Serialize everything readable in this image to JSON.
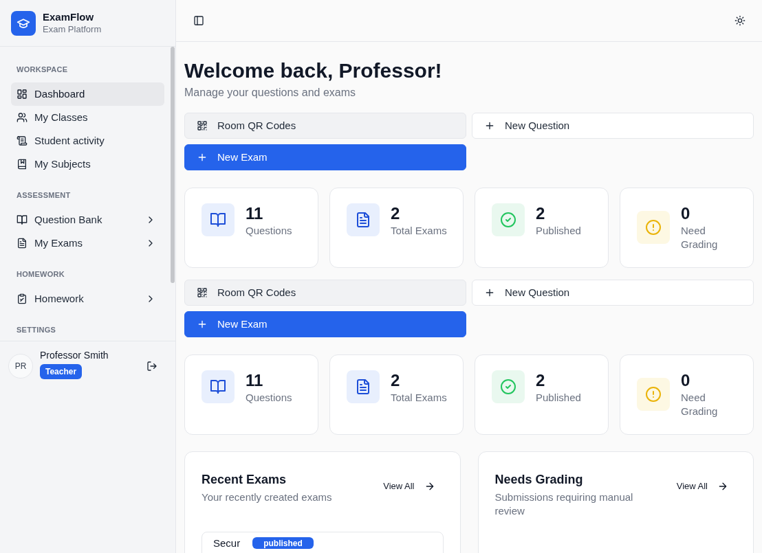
{
  "brand": {
    "name": "ExamFlow",
    "tagline": "Exam Platform"
  },
  "nav_sections": [
    {
      "label": "WORKSPACE",
      "items": [
        {
          "label": "Dashboard",
          "kind": "grid",
          "selected": true,
          "submenu": false
        },
        {
          "label": "My Classes",
          "kind": "users",
          "selected": false,
          "submenu": false
        },
        {
          "label": "Student activity",
          "kind": "scroll",
          "selected": false,
          "submenu": false
        },
        {
          "label": "My Subjects",
          "kind": "book-marked",
          "selected": false,
          "submenu": false
        }
      ]
    },
    {
      "label": "ASSESSMENT",
      "items": [
        {
          "label": "Question Bank",
          "kind": "book",
          "selected": false,
          "submenu": true
        },
        {
          "label": "My Exams",
          "kind": "file",
          "selected": false,
          "submenu": true
        }
      ]
    },
    {
      "label": "HOMEWORK",
      "items": [
        {
          "label": "Homework",
          "kind": "clipboard",
          "selected": false,
          "submenu": true
        }
      ]
    },
    {
      "label": "SETTINGS"
    }
  ],
  "user": {
    "initials": "PR",
    "name": "Professor Smith",
    "role": "Teacher"
  },
  "page": {
    "title": "Welcome back, Professor!",
    "subtitle": "Manage your questions and exams"
  },
  "sections": [
    {
      "actions": [
        {
          "label": "Room QR Codes",
          "kind": "qr"
        },
        {
          "label": "New Question",
          "kind": "outline"
        },
        {
          "label": "New Exam",
          "kind": "primary"
        }
      ],
      "stats": [
        {
          "value": "11",
          "label": "Questions",
          "kind": "book"
        },
        {
          "value": "2",
          "label": "Total Exams",
          "kind": "file"
        },
        {
          "value": "2",
          "label": "Published",
          "kind": "check"
        },
        {
          "value": "0",
          "label": "Need Grading",
          "kind": "alert"
        }
      ]
    },
    {
      "actions": [
        {
          "label": "Room QR Codes",
          "kind": "qr"
        },
        {
          "label": "New Question",
          "kind": "outline"
        },
        {
          "label": "New Exam",
          "kind": "primary"
        }
      ],
      "stats": [
        {
          "value": "11",
          "label": "Questions",
          "kind": "book"
        },
        {
          "value": "2",
          "label": "Total Exams",
          "kind": "file"
        },
        {
          "value": "2",
          "label": "Published",
          "kind": "check"
        },
        {
          "value": "0",
          "label": "Need Grading",
          "kind": "alert"
        }
      ]
    }
  ],
  "panels": [
    {
      "title": "Recent Exams",
      "subtitle": "Your recently created exams",
      "link": "View All",
      "items": [
        {
          "title": "Secur",
          "status": "published"
        }
      ]
    },
    {
      "title": "Needs Grading",
      "subtitle": "Submissions requiring manual review",
      "link": "View All"
    }
  ]
}
